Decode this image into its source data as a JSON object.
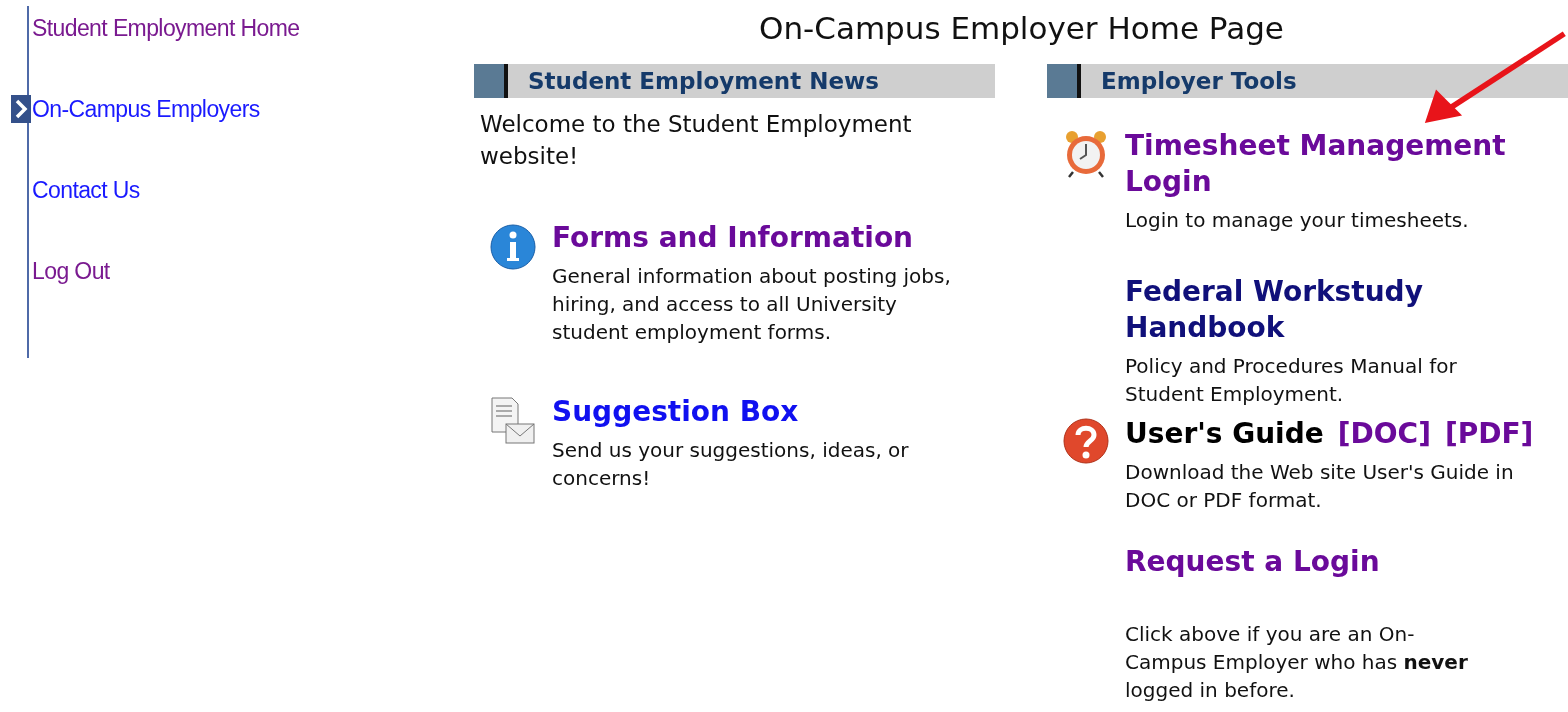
{
  "sidebar": {
    "items": [
      {
        "label": "Student Employment Home",
        "selected": false,
        "visited": true
      },
      {
        "label": "On-Campus Employers",
        "selected": true,
        "visited": false
      },
      {
        "label": "Contact Us",
        "selected": false,
        "visited": false
      },
      {
        "label": "Log Out",
        "selected": false,
        "visited": true
      }
    ]
  },
  "page_title": "On-Campus Employer Home Page",
  "news": {
    "heading": "Student Employment News",
    "intro": "Welcome to the Student Employment website!",
    "items": [
      {
        "kind": "info",
        "title": "Forms and Information",
        "color": "#6a0a9a",
        "description": "General information about posting jobs, hiring, and access to all University student employment forms."
      },
      {
        "kind": "mail",
        "title": "Suggestion Box",
        "color": "#1010f0",
        "description": "Send us your suggestions, ideas, or concerns!"
      }
    ]
  },
  "tools": {
    "heading": "Employer Tools",
    "items": [
      {
        "kind": "clock",
        "title": "Timesheet Management Login",
        "color": "#6a0a9a",
        "description": "Login to manage your timesheets."
      },
      {
        "kind": "plain",
        "title": "Federal Workstudy Handbook",
        "color": "#10107a",
        "description": "Policy and Procedures Manual for Student Employment."
      },
      {
        "kind": "help",
        "title": "User's Guide",
        "color": "#000000",
        "links": [
          {
            "label": "[DOC]"
          },
          {
            "label": "[PDF]"
          }
        ],
        "description": "Download the Web site User's Guide in DOC or PDF format."
      },
      {
        "kind": "plain",
        "title": "Request a Login",
        "color": "#6a0a9a",
        "description": "Click above if you are an On-Campus Employer who has **never** logged in before."
      }
    ]
  }
}
